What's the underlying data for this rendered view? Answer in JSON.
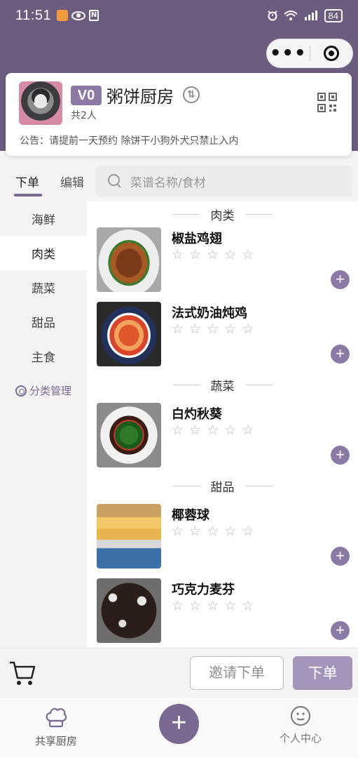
{
  "status_bar": {
    "time": "11:51",
    "battery": "84"
  },
  "kitchen": {
    "vip_level": "V0",
    "name": "粥饼厨房",
    "switch_glyph": "⇅",
    "members": "共2人",
    "notice": "公告：请提前一天预约 除饼干小狗外犬只禁止入内"
  },
  "tabs": {
    "order": "下单",
    "edit": "编辑"
  },
  "search": {
    "placeholder": "菜谱名称/食材"
  },
  "categories": [
    {
      "label": "海鲜",
      "active": false
    },
    {
      "label": "肉类",
      "active": true
    },
    {
      "label": "蔬菜",
      "active": false
    },
    {
      "label": "甜品",
      "active": false
    },
    {
      "label": "主食",
      "active": false
    }
  ],
  "category_manage": "分类管理",
  "menu": {
    "sections": [
      "肉类",
      "蔬菜",
      "甜品"
    ],
    "dishes": [
      {
        "name": "椒盐鸡翅",
        "section": "肉类",
        "rating": 0,
        "image": "salt-pepper-chicken-wings-photo"
      },
      {
        "name": "法式奶油炖鸡",
        "section": "肉类",
        "rating": 0,
        "image": "french-cream-chicken-photo"
      },
      {
        "name": "白灼秋葵",
        "section": "蔬菜",
        "rating": 0,
        "image": "blanched-okra-photo"
      },
      {
        "name": "椰蓉球",
        "section": "甜品",
        "rating": 0,
        "image": "coconut-balls-photo"
      },
      {
        "name": "巧克力麦芬",
        "section": "甜品",
        "rating": 0,
        "image": "chocolate-muffin-photo"
      }
    ],
    "star_glyph": "☆",
    "add_glyph": "+"
  },
  "actions": {
    "invite": "邀请下单",
    "order": "下单"
  },
  "tabbar": {
    "kitchen": "共享厨房",
    "center": "+",
    "profile": "个人中心"
  },
  "colors": {
    "header": "#6c5c80",
    "accent": "#8c7aa6",
    "order_button": "#a395b9"
  }
}
